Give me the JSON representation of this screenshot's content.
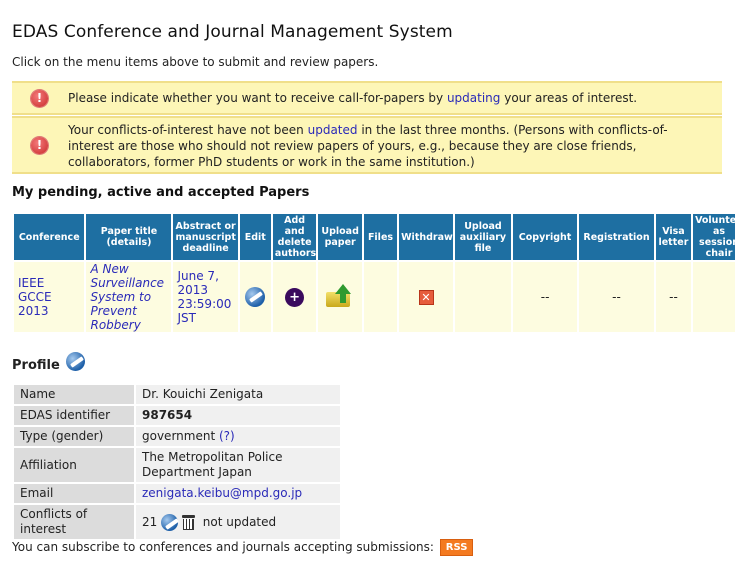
{
  "header": {
    "title": "EDAS Conference and Journal Management System",
    "subtitle": "Click on the menu items above to submit and review papers."
  },
  "notices": [
    {
      "icon": "warning-icon",
      "pre": "Please indicate whether you want to receive call-for-papers by ",
      "link": "updating",
      "post": " your areas of interest."
    },
    {
      "icon": "warning-icon",
      "pre": "Your conflicts-of-interest have not been ",
      "link": "updated",
      "post": " in the last three months. (Persons with conflicts-of-interest are those who should not review papers of yours, e.g., because they are close friends, collaborators, former PhD students or work in the same institution.)"
    }
  ],
  "papers": {
    "heading": "My pending, active and accepted Papers",
    "columns": [
      "Conference",
      "Paper title (details)",
      "Abstract or manuscript deadline",
      "Edit",
      "Add and delete authors",
      "Upload paper",
      "Files",
      "Withdraw",
      "Upload auxiliary file",
      "Copyright",
      "Registration",
      "Visa letter",
      "Volunteer as session chair"
    ],
    "row": {
      "conference": "IEEE GCCE 2013",
      "paper_title": "A New Surveillance System to Prevent Robbery",
      "deadline": "June 7, 2013 23:59:00 JST",
      "withdraw_symbol": "✕",
      "copyright": "--",
      "registration": "--",
      "visa": "--"
    }
  },
  "profile": {
    "heading": "Profile",
    "rows": {
      "name_label": "Name",
      "name_value": "Dr. Kouichi Zenigata",
      "id_label": "EDAS identifier",
      "id_value": "987654",
      "type_label": "Type (gender)",
      "type_value": "government",
      "type_help": "(?)",
      "affiliation_label": "Affiliation",
      "affiliation_value": "The Metropolitan Police Department Japan",
      "email_label": "Email",
      "email_value": "zenigata.keibu@mpd.go.jp",
      "conflicts_label": "Conflicts of interest",
      "conflicts_count": "21",
      "conflicts_status": "not updated"
    }
  },
  "footer": {
    "text": "You can subscribe to conferences and journals accepting submissions: ",
    "rss_label": "RSS"
  },
  "colors": {
    "table_header": "#1e6fa2",
    "notice_bg": "#fdf6b7",
    "link": "#2a2ab8",
    "rss": "#f47a20"
  }
}
